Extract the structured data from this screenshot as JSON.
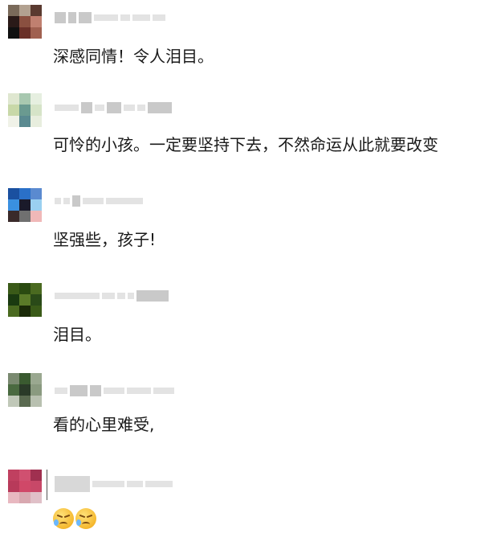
{
  "comments": [
    {
      "text": "深感同情！令人泪目。",
      "avatar_colors": [
        "#7a6a5a",
        "#b2a190",
        "#5a3a30",
        "#2a1a18",
        "#8a5040",
        "#c08070",
        "#101010",
        "#6a3028",
        "#a06050"
      ]
    },
    {
      "text": "可怜的小孩。一定要坚持下去，不然命运从此就要改变",
      "avatar_colors": [
        "#dfe7d0",
        "#a8c8b0",
        "#e6efe0",
        "#c8d8a8",
        "#6a9a90",
        "#d6e4c8",
        "#f0f2e8",
        "#5a8a90",
        "#e8eede"
      ]
    },
    {
      "text": "坚强些，孩子!",
      "avatar_colors": [
        "#1a50a0",
        "#2a70c8",
        "#5a8ad0",
        "#3a90e0",
        "#1a1a2a",
        "#9ad0f0",
        "#3a2a2a",
        "#707070",
        "#f0b8b8"
      ]
    },
    {
      "text": "泪目。",
      "avatar_colors": [
        "#3a5a18",
        "#2a4a10",
        "#4a6a20",
        "#1a3a10",
        "#5a7a28",
        "#2a4a18",
        "#4a6a20",
        "#1a2a08",
        "#3a5a18"
      ]
    },
    {
      "text": "看的心里难受,",
      "avatar_colors": [
        "#7a8a70",
        "#3a5a30",
        "#9aa890",
        "#4a6a40",
        "#2a3a28",
        "#8a9a80",
        "#c0c8b8",
        "#5a6a50",
        "#b8c0b0"
      ]
    },
    {
      "text": "",
      "emoji": [
        "sad-face-icon",
        "sad-face-icon"
      ],
      "avatar_colors": [
        "#c04060",
        "#d05070",
        "#a03050",
        "#b83a5a",
        "#d04868",
        "#c84868",
        "#e8b8c0",
        "#d8a8b0",
        "#e0c0c8"
      ]
    }
  ]
}
